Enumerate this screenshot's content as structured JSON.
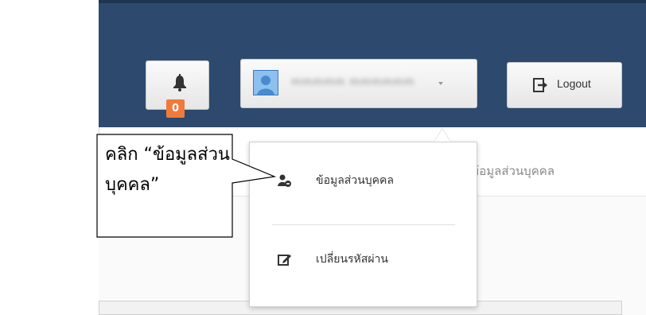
{
  "header": {
    "notifications": {
      "count": "0",
      "icon": "bell-icon"
    },
    "user": {
      "name": "mmmmm mmmmmm",
      "avatar_icon": "user-avatar-icon"
    },
    "logout": {
      "label": "Logout",
      "icon": "logout-icon"
    }
  },
  "page": {
    "title": "ข้อมูลส่วนบุคคล"
  },
  "dropdown": {
    "items": [
      {
        "label": "ข้อมูลส่วนบุคคล",
        "icon": "user-profile-icon"
      },
      {
        "label": "เปลี่ยนรหัสผ่าน",
        "icon": "edit-icon"
      }
    ]
  },
  "callout": {
    "line1": "คลิก “ข้อมูลส่วน",
    "line2": "บุคคล”"
  },
  "colors": {
    "header_bg": "#2d4a6e",
    "badge": "#f07a3a"
  }
}
